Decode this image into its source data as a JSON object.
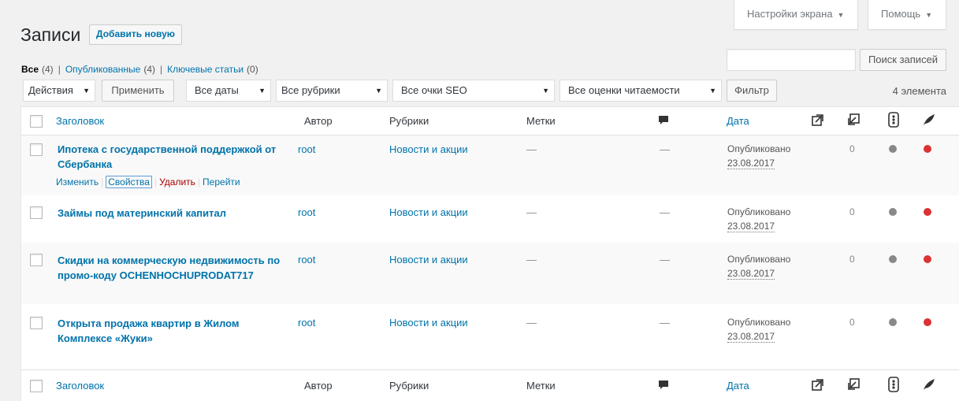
{
  "screen_options_label": "Настройки экрана",
  "help_label": "Помощь",
  "page_title": "Записи",
  "add_new_label": "Добавить новую",
  "views": [
    {
      "label": "Все",
      "count": "(4)"
    },
    {
      "label": "Опубликованные",
      "count": "(4)"
    },
    {
      "label": "Ключевые статьи",
      "count": "(0)"
    }
  ],
  "search": {
    "button": "Поиск записей",
    "value": ""
  },
  "filters": {
    "bulk_action": "Действия",
    "apply": "Применить",
    "dates": "Все даты",
    "categories": "Все рубрики",
    "seo": "Все очки SEO",
    "readability": "Все оценки читаемости",
    "filter_button": "Фильтр",
    "items_count": "4 элемента"
  },
  "columns": {
    "title": "Заголовок",
    "author": "Автор",
    "categories": "Рубрики",
    "tags": "Метки",
    "date": "Дата"
  },
  "row_actions": {
    "edit": "Изменить",
    "quick_edit": "Свойства",
    "trash": "Удалить",
    "view": "Перейти"
  },
  "posts": [
    {
      "title": "Ипотека с государственной поддержкой от Сбербанка",
      "author": "root",
      "category": "Новости и акции",
      "tags": "—",
      "comments": "—",
      "status": "Опубликовано",
      "date": "23.08.2017",
      "links": "0",
      "seo_color": "#888888",
      "read_color": "#dc3232"
    },
    {
      "title": "Займы под материнский капитал",
      "author": "root",
      "category": "Новости и акции",
      "tags": "—",
      "comments": "—",
      "status": "Опубликовано",
      "date": "23.08.2017",
      "links": "0",
      "seo_color": "#888888",
      "read_color": "#dc3232"
    },
    {
      "title": "Скидки на коммерческую недвижимость по промо-коду OCHENHOCHUPRODAT717",
      "author": "root",
      "category": "Новости и акции",
      "tags": "—",
      "comments": "—",
      "status": "Опубликовано",
      "date": "23.08.2017",
      "links": "0",
      "seo_color": "#888888",
      "read_color": "#dc3232"
    },
    {
      "title": "Открыта продажа квартир в Жилом Комплексе «Жуки»",
      "author": "root",
      "category": "Новости и акции",
      "tags": "—",
      "comments": "—",
      "status": "Опубликовано",
      "date": "23.08.2017",
      "links": "0",
      "seo_color": "#888888",
      "read_color": "#dc3232"
    }
  ],
  "header_icons": [
    "comment-bubble-icon",
    "outgoing-links-icon",
    "incoming-links-icon",
    "seo-score-icon",
    "readability-score-icon"
  ]
}
